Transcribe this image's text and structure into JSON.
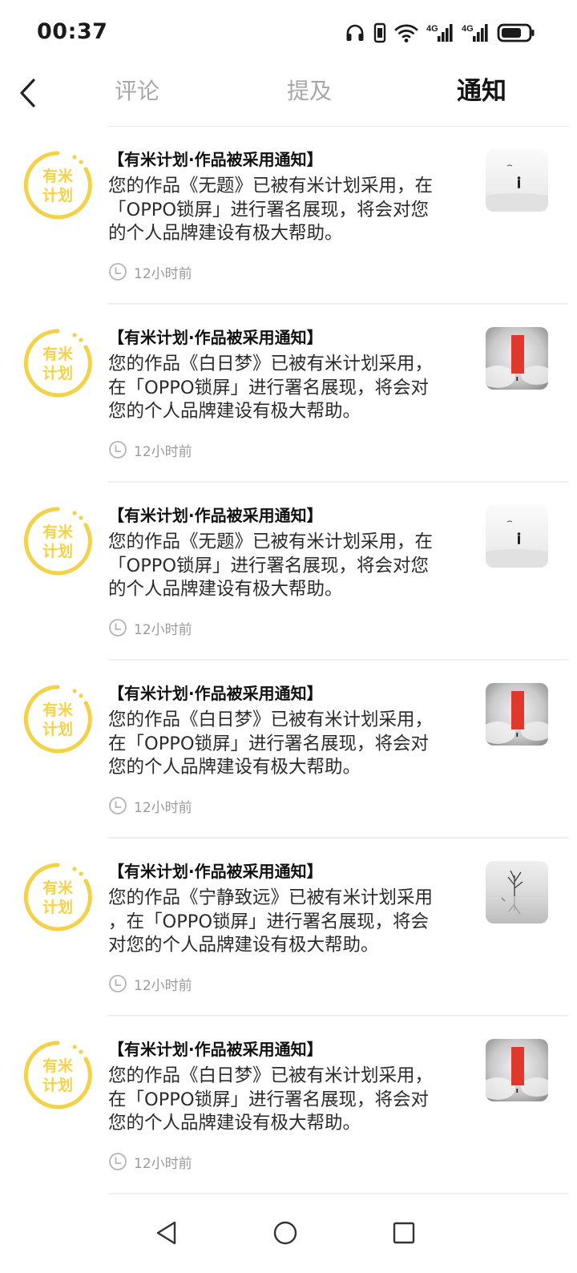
{
  "status_bar": {
    "time": "00:37",
    "icons": [
      "headphones-icon",
      "vibrate-icon",
      "wifi-icon",
      "signal-4g-icon",
      "signal-4g-icon",
      "battery-icon"
    ],
    "network_label_1": "4G",
    "network_label_2": "4G"
  },
  "header": {
    "back_icon": "chevron-left-icon",
    "tabs": [
      {
        "label": "评论",
        "active": false
      },
      {
        "label": "提及",
        "active": false
      },
      {
        "label": "通知",
        "active": true
      }
    ]
  },
  "avatar_text": {
    "line1": "有米",
    "line2": "计划"
  },
  "colors": {
    "brand_yellow": "#f3d24a",
    "divider": "#f0f0f0",
    "muted": "#9b9b9b",
    "red_door": "#e2372b"
  },
  "notifications": [
    {
      "title": "【有米计划·作品被采用通知】",
      "body_line1": "您的作品《无题》已被有米计划采用，在",
      "body_line2": "「OPPO锁屏」进行署名展现，将会对您",
      "body_line3": "的个人品牌建设有极大帮助。",
      "time": "12小时前",
      "thumbnail": "white-landscape-figure"
    },
    {
      "title": "【有米计划·作品被采用通知】",
      "body_line1": "您的作品《白日梦》已被有米计划采用，",
      "body_line2": "在「OPPO锁屏」进行署名展现，将会对",
      "body_line3": "您的个人品牌建设有极大帮助。",
      "time": "12小时前",
      "thumbnail": "red-door-clouds"
    },
    {
      "title": "【有米计划·作品被采用通知】",
      "body_line1": "您的作品《无题》已被有米计划采用，在",
      "body_line2": "「OPPO锁屏」进行署名展现，将会对您",
      "body_line3": "的个人品牌建设有极大帮助。",
      "time": "12小时前",
      "thumbnail": "white-landscape-figure"
    },
    {
      "title": "【有米计划·作品被采用通知】",
      "body_line1": "您的作品《白日梦》已被有米计划采用，",
      "body_line2": "在「OPPO锁屏」进行署名展现，将会对",
      "body_line3": "您的个人品牌建设有极大帮助。",
      "time": "12小时前",
      "thumbnail": "red-door-clouds"
    },
    {
      "title": "【有米计划·作品被采用通知】",
      "body_line1": "您的作品《宁静致远》已被有米计划采用",
      "body_line2": "，在「OPPO锁屏」进行署名展现，将会",
      "body_line3": "对您的个人品牌建设有极大帮助。",
      "time": "12小时前",
      "thumbnail": "bare-tree-reflection"
    },
    {
      "title": "【有米计划·作品被采用通知】",
      "body_line1": "您的作品《白日梦》已被有米计划采用，",
      "body_line2": "在「OPPO锁屏」进行署名展现，将会对",
      "body_line3": "您的个人品牌建设有极大帮助。",
      "time": "12小时前",
      "thumbnail": "red-door-clouds"
    }
  ],
  "nav_bar": {
    "buttons": [
      "triangle-back-icon",
      "circle-home-icon",
      "square-recents-icon"
    ]
  }
}
